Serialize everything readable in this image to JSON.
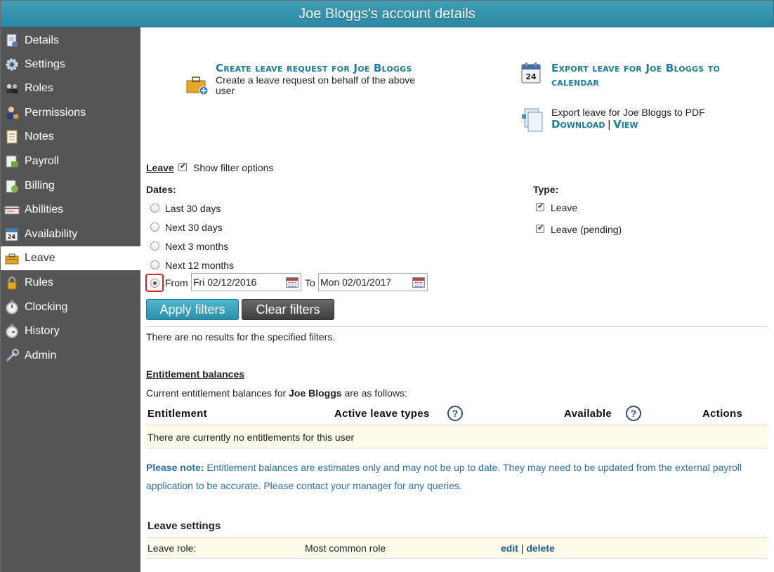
{
  "window": {
    "title": "Joe Bloggs's account details"
  },
  "sidebar": {
    "items": [
      {
        "label": "Details",
        "icon": "document-icon"
      },
      {
        "label": "Settings",
        "icon": "gear-icon"
      },
      {
        "label": "Roles",
        "icon": "roles-icon"
      },
      {
        "label": "Permissions",
        "icon": "user-lock-icon"
      },
      {
        "label": "Notes",
        "icon": "notepad-icon"
      },
      {
        "label": "Payroll",
        "icon": "payroll-icon"
      },
      {
        "label": "Billing",
        "icon": "billing-icon"
      },
      {
        "label": "Abilities",
        "icon": "card-icon"
      },
      {
        "label": "Availability",
        "icon": "calendar-icon"
      },
      {
        "label": "Leave",
        "icon": "suitcase-icon",
        "active": true
      },
      {
        "label": "Rules",
        "icon": "padlock-icon"
      },
      {
        "label": "Clocking",
        "icon": "stopwatch-icon"
      },
      {
        "label": "History",
        "icon": "stopwatch-icon"
      },
      {
        "label": "Admin",
        "icon": "wrench-icon"
      }
    ]
  },
  "actions": {
    "create": {
      "title": "Create leave request for Joe Bloggs",
      "desc": "Create a leave request on behalf of the above user"
    },
    "export_cal": {
      "title": "Export leave for Joe Bloggs to calendar",
      "calendar_day": "24"
    },
    "export_pdf": {
      "desc": "Export leave for Joe Bloggs to PDF",
      "download": "Download",
      "sep": "|",
      "view": "View"
    }
  },
  "filters": {
    "section_label": "Leave",
    "show_filter_options": "Show filter options",
    "dates_label": "Dates:",
    "type_label": "Type:",
    "date_options": [
      "Last 30 days",
      "Next 30 days",
      "Next 3 months",
      "Next 12 months"
    ],
    "from_label": "From",
    "from_value": "Fri 02/12/2016",
    "to_label": "To",
    "to_value": "Mon 02/01/2017",
    "types": [
      "Leave",
      "Leave (pending)"
    ],
    "apply_label": "Apply filters",
    "clear_label": "Clear filters",
    "no_results": "There are no results for the specified filters."
  },
  "entitlements": {
    "heading": "Entitlement balances",
    "intro_pre": "Current entitlement balances for",
    "intro_name": "Joe Bloggs",
    "intro_post": "are as follows:",
    "columns": [
      "Entitlement",
      "Active leave types",
      "Available",
      "Actions"
    ],
    "help_glyph": "?",
    "empty": "There are currently no entitlements for this user",
    "note_label": "Please note:",
    "note_line1": "Entitlement balances are estimates only and may not be up to date. They may need to be updated from the external payroll",
    "note_line2": "application to be accurate. Please contact your manager for any queries."
  },
  "leave_settings": {
    "heading": "Leave settings",
    "row_label": "Leave role:",
    "row_value": "Most common role",
    "edit": "edit",
    "sep": "|",
    "delete": "delete"
  }
}
